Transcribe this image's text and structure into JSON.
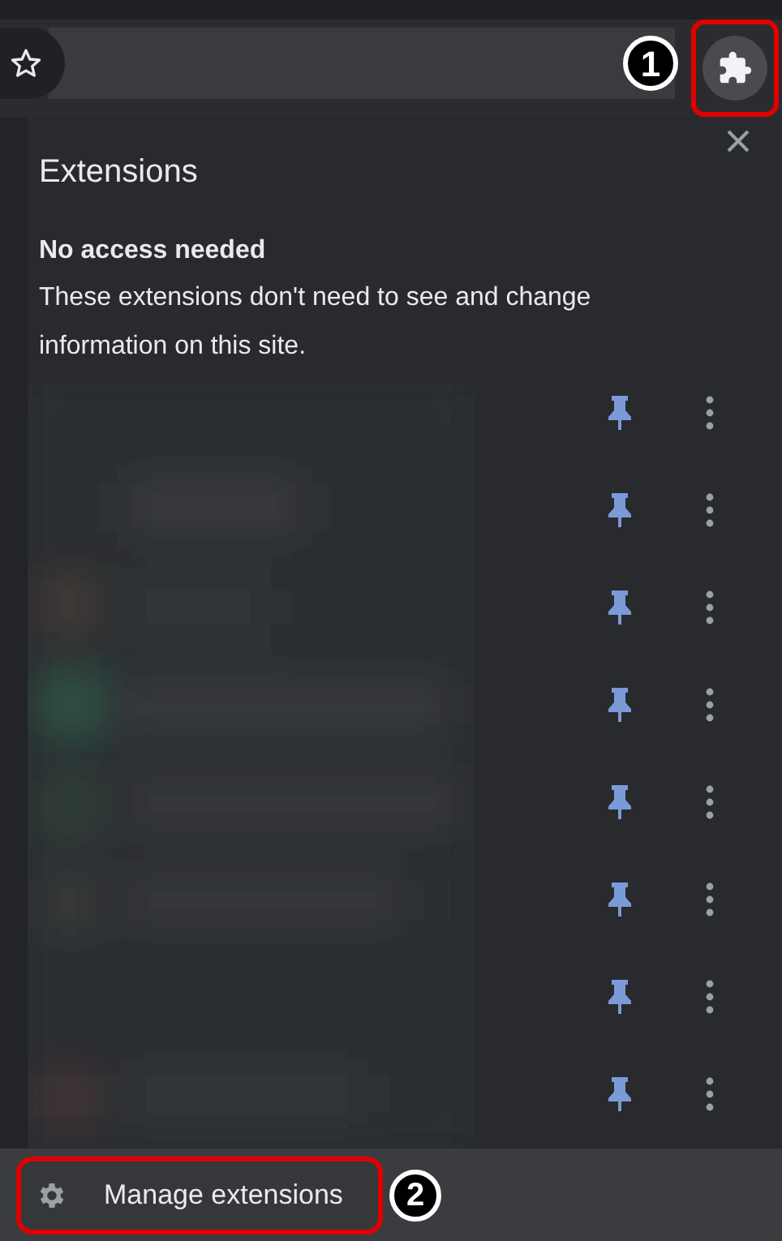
{
  "toolbar": {
    "bookmark_starred": false,
    "callout": "1"
  },
  "panel": {
    "title": "Extensions",
    "section_heading": "No access needed",
    "section_text": "These extensions don't need to see and change information on this site.",
    "extensions": [
      {
        "kind": "picture",
        "pinned": true
      },
      {
        "kind": "picture",
        "pinned": true
      },
      {
        "kind": "picture",
        "pinned": true
      },
      {
        "kind": "picture",
        "pinned": true
      },
      {
        "kind": "picture",
        "pinned": true
      },
      {
        "kind": "picture",
        "pinned": true
      },
      {
        "kind": "picture",
        "pinned": true
      },
      {
        "kind": "picture",
        "pinned": true
      }
    ],
    "footer": {
      "label": "Manage extensions",
      "callout": "2"
    }
  }
}
